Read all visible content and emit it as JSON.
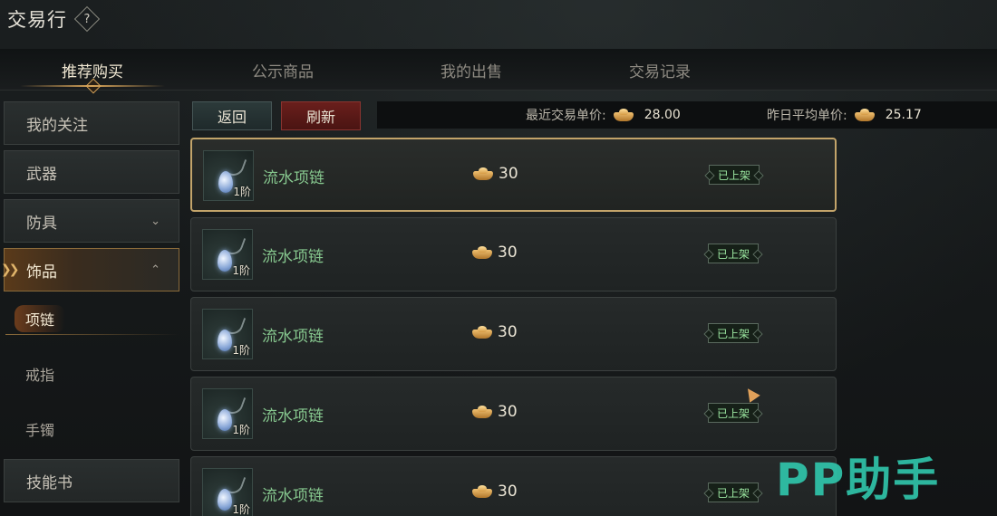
{
  "header": {
    "title": "交易行",
    "help_icon": "?"
  },
  "tabs": [
    {
      "label": "推荐购买",
      "active": true
    },
    {
      "label": "公示商品",
      "active": false
    },
    {
      "label": "我的出售",
      "active": false
    },
    {
      "label": "交易记录",
      "active": false
    }
  ],
  "sidebar": {
    "items": [
      {
        "label": "我的关注"
      },
      {
        "label": "武器"
      },
      {
        "label": "防具",
        "chevron": "⌄"
      },
      {
        "label": "饰品",
        "chevron": "⌃",
        "active": true
      },
      {
        "label": "技能书"
      }
    ],
    "sub_items": [
      {
        "label": "项链",
        "active": true
      },
      {
        "label": "戒指"
      },
      {
        "label": "手镯"
      }
    ]
  },
  "toolbar": {
    "back_label": "返回",
    "refresh_label": "刷新",
    "recent_price_label": "最近交易单价:",
    "recent_price_value": "28.00",
    "yesterday_price_label": "昨日平均单价:",
    "yesterday_price_value": "25.17"
  },
  "listings": [
    {
      "name": "流水项链",
      "tier": "1阶",
      "price": "30",
      "status": "已上架",
      "selected": true
    },
    {
      "name": "流水项链",
      "tier": "1阶",
      "price": "30",
      "status": "已上架"
    },
    {
      "name": "流水项链",
      "tier": "1阶",
      "price": "30",
      "status": "已上架"
    },
    {
      "name": "流水项链",
      "tier": "1阶",
      "price": "30",
      "status": "已上架"
    },
    {
      "name": "流水项链",
      "tier": "1阶",
      "price": "30",
      "status": "已上架"
    }
  ],
  "watermark": "PP助手",
  "colors": {
    "item_name": "#86c78e",
    "accent_gold": "#d8a55a",
    "refresh_red": "#6a1f1c",
    "watermark": "#30c4aa"
  }
}
